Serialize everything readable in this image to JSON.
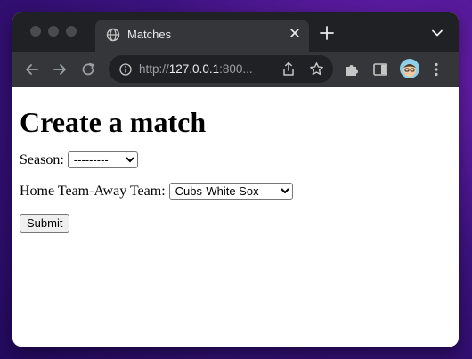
{
  "browser": {
    "tab": {
      "title": "Matches"
    },
    "address_bar": {
      "scheme": "http://",
      "host": "127.0.0.1",
      "rest": ":800..."
    }
  },
  "page": {
    "heading": "Create a match",
    "season": {
      "label": "Season:",
      "selected": "---------"
    },
    "teams": {
      "label": "Home Team-Away Team:",
      "selected": "Cubs-White Sox"
    },
    "submit_label": "Submit"
  }
}
